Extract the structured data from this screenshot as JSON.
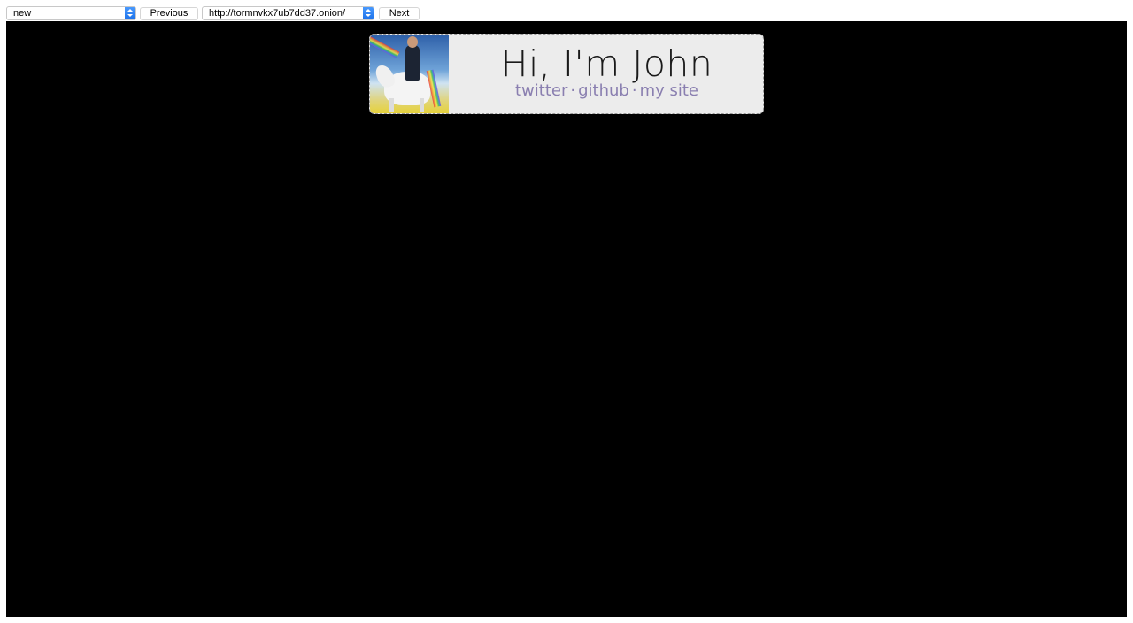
{
  "toolbar": {
    "category_select": {
      "value": "new"
    },
    "previous_label": "Previous",
    "url_select": {
      "value": "http://tormnvkx7ub7dd37.onion/"
    },
    "next_label": "Next"
  },
  "page": {
    "heading": "Hi, I'm John",
    "links": [
      {
        "label": "twitter"
      },
      {
        "label": "github"
      },
      {
        "label": "my site"
      }
    ],
    "separator": "·",
    "colors": {
      "viewport_background": "#000000",
      "card_background": "#ececec",
      "link_color": "#8a7fb0",
      "select_arrow": "#1a6fe8"
    },
    "avatar": {
      "description_icon": "avatar-image"
    }
  }
}
